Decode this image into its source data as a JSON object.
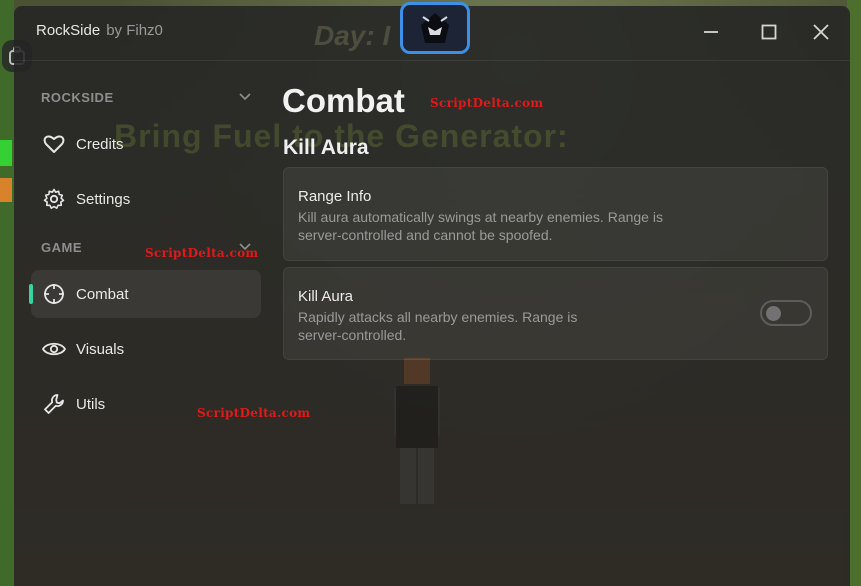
{
  "window": {
    "app_name": "RockSide",
    "author": "by Fihz0",
    "controls": {
      "minimize_icon": "minimize-icon",
      "maximize_icon": "maximize-icon",
      "close_icon": "close-icon"
    }
  },
  "background": {
    "day_text": "Day: I",
    "banner_text": "Bring Fuel to the Generator:"
  },
  "sidebar": {
    "sections": [
      {
        "header": "ROCKSIDE",
        "items": [
          {
            "label": "Credits",
            "icon": "heart-icon"
          },
          {
            "label": "Settings",
            "icon": "gear-icon"
          }
        ]
      },
      {
        "header": "GAME",
        "items": [
          {
            "label": "Combat",
            "icon": "crosshair-icon",
            "active": true
          },
          {
            "label": "Visuals",
            "icon": "eye-icon"
          },
          {
            "label": "Utils",
            "icon": "wrench-icon"
          }
        ]
      }
    ]
  },
  "main": {
    "page_title": "Combat",
    "section_title": "Kill Aura",
    "cards": [
      {
        "title": "Range Info",
        "desc_lines": [
          "Kill aura automatically swings at nearby enemies. Range is",
          "server-controlled and cannot be spoofed."
        ]
      },
      {
        "title": "Kill Aura",
        "desc_lines": [
          "Rapidly attacks all nearby enemies. Range is",
          "server-controlled."
        ],
        "toggle_on": false
      }
    ]
  },
  "watermarks": [
    "ScriptDelta.com",
    "ScriptDelta.com",
    "ScriptDelta.com"
  ],
  "colors": {
    "accent": "#37d3a0",
    "logo_border": "#3d8fe8",
    "watermark": "#e01a1a"
  }
}
